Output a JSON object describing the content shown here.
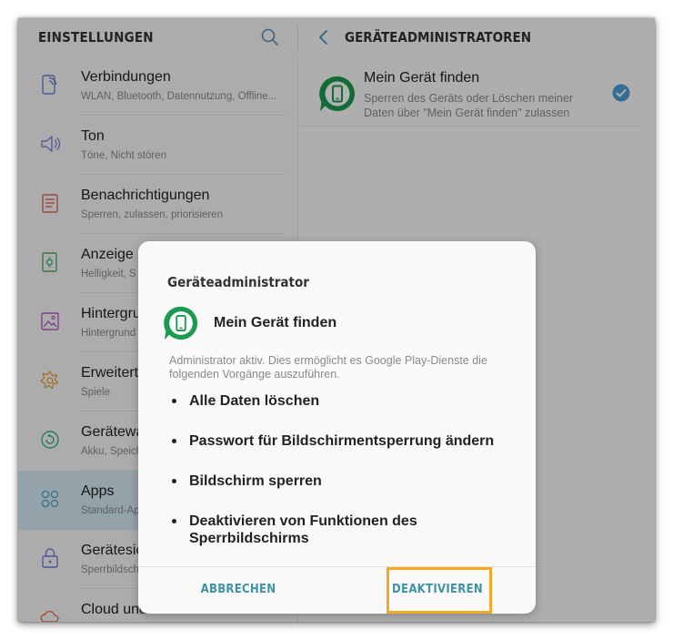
{
  "left": {
    "title": "EINSTELLUNGEN",
    "items": [
      {
        "title": "Verbindungen",
        "subtitle": "WLAN, Bluetooth, Datennutzung, Offline...",
        "icon": "connections-icon"
      },
      {
        "title": "Ton",
        "subtitle": "Töne, Nicht stören",
        "icon": "speaker-icon"
      },
      {
        "title": "Benachrichtigungen",
        "subtitle": "Sperren, zulassen, priorisieren",
        "icon": "notifications-icon"
      },
      {
        "title": "Anzeige",
        "subtitle": "Helligkeit, S",
        "icon": "display-icon"
      },
      {
        "title": "Hintergru",
        "subtitle": "Hintergrund",
        "icon": "wallpaper-icon"
      },
      {
        "title": "Erweitert",
        "subtitle": "Spiele",
        "icon": "advanced-features-icon"
      },
      {
        "title": "Gerätewa",
        "subtitle": "Akku, Speich",
        "icon": "device-maintenance-icon"
      },
      {
        "title": "Apps",
        "subtitle": "Standard-Ap",
        "icon": "apps-icon",
        "active": true
      },
      {
        "title": "Gerätesic",
        "subtitle": "Sperrbildsch",
        "icon": "lock-icon"
      },
      {
        "title": "Cloud und Konten",
        "subtitle": "",
        "icon": "cloud-icon"
      }
    ]
  },
  "right": {
    "title": "GERÄTEADMINISTRATOREN",
    "admin": {
      "title": "Mein Gerät finden",
      "description": "Sperren des Geräts oder Löschen meiner Daten über \"Mein Gerät finden\" zulassen",
      "checked": true
    }
  },
  "dialog": {
    "title": "Geräteadministrator",
    "app_name": "Mein Gerät finden",
    "description": "Administrator aktiv. Dies ermöglicht es Google Play-Dienste die folgenden Vorgänge auszuführen.",
    "items": [
      "Alle Daten löschen",
      "Passwort für Bildschirmentsperrung ändern",
      "Bildschirm sperren",
      "Deaktivieren von Funktionen des Sperrbildschirms"
    ],
    "cancel_label": "ABBRECHEN",
    "deactivate_label": "DEAKTIVIEREN"
  },
  "colors": {
    "accent": "#3e93a6",
    "active_row": "#d5e9f2",
    "find_device_green": "#1c9a4f",
    "checkbox_blue": "#4a9fd5",
    "highlight": "#f5a623"
  }
}
